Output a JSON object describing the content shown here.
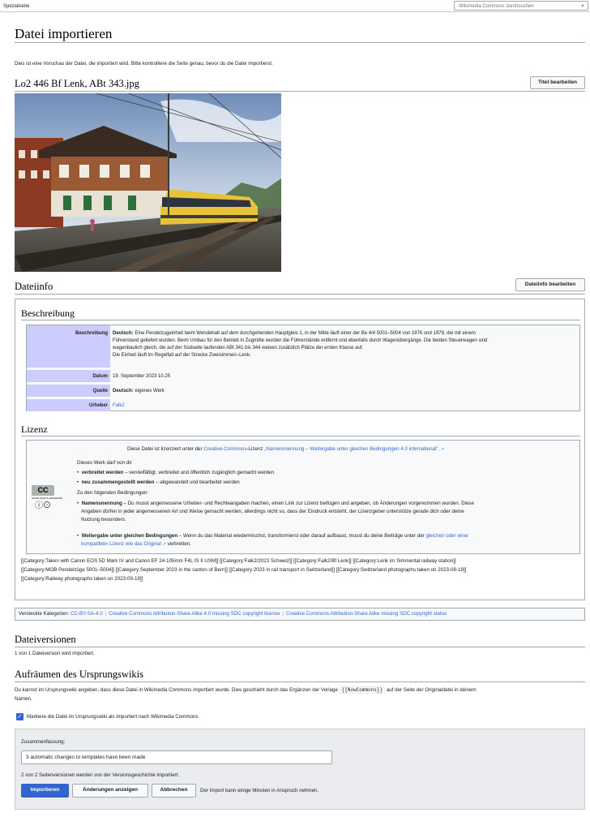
{
  "topbar": {
    "special_page": "Spezialseite",
    "search_placeholder": "Wikimedia Commons durchsuchen"
  },
  "page_title": "Datei importieren",
  "intro": "Dies ist eine Vorschau der Datei, die importiert wird. Bitte kontrolliere die Seite genau, bevor du die Datei importierst.",
  "file_title": "Lo2 446 Bf Lenk, ABt 343.jpg",
  "edit_title_button": "Titel bearbeiten",
  "fileinfo_heading": "Dateiinfo",
  "edit_fileinfo_button": "Dateiinfo bearbeiten",
  "description": {
    "heading": "Beschreibung",
    "label_description": "Beschreibung",
    "lang": "Deutsch:",
    "lines": [
      "Eine Pendelzugeinheit beim Wendehalt auf dem durchgehenden Hauptgleis 1, in der Mitte läuft einer der Be 4/4 5001–5004 von 1976 und 1979, die mit einem",
      "Führerstand geliefert wurden. Beim Umbau für den Betrieb in Zugmitte wurden die Führerstände entfernt und ebenfalls durch Wagenübergänge. Die beiden Steuerwagen sind",
      "wagenbaulich gleich, die auf der Südseite laufenden ABt 341 bis 344 weisen zusätzlich Plätze der ersten Klasse auf.",
      "Die Einheit läuft im Regelfall auf der Strecke Zweisimmen–Lenk."
    ],
    "label_date": "Datum",
    "date": "19. September 2023 10.25",
    "label_source": "Quelle",
    "source_lang": "Deutsch:",
    "source": "eigenes Werk",
    "label_author": "Urheber",
    "author": "Falk2"
  },
  "license": {
    "heading": "Lizenz",
    "intro_pre": "Diese Datei ist lizenziert unter der",
    "cc_link": "Creative-Commons",
    "intro_mid": "-Lizenz",
    "license_link": "„Namensnennung – Weitergabe unter gleichen Bedingungen 4.0 international“.",
    "free_to": "Dieses Werk darf von dir",
    "share_bold": "verbreitet werden",
    "share_text": "– vervielfältigt, verbreitet und öffentlich zugänglich gemacht werden",
    "remix_bold": "neu zusammengestellt werden",
    "remix_text": "– abgewandelt und bearbeitet werden",
    "conditions": "Zu den folgenden Bedingungen:",
    "attr_bold": "Namensnennung",
    "attr_lines": [
      "– Du musst angemessene Urheber- und Rechteangaben machen, einen Link zur Lizenz beifügen und angeben, ob Änderungen vorgenommen wurden. Diese",
      "Angaben dürfen in jeder angemessenen Art und Weise gemacht werden, allerdings nicht so, dass der Eindruck entsteht, der Lizenzgeber unterstütze gerade dich oder deine",
      "Nutzung besonders."
    ],
    "sa_bold": "Weitergabe unter gleichen Bedingungen",
    "sa_text": "– Wenn du das Material wiedermischst, transformierst oder darauf aufbaust, musst du deine Beiträge unter der",
    "sa_link1": "gleichen oder einer",
    "sa_link2": "kompatiblen Lizenz wie das Original",
    "sa_end": "verbreiten.",
    "logo_top": "CC",
    "logo_caption": "SOME RIGHTS RESERVED"
  },
  "categories_raw": [
    "[[Category:Taken with Canon EOS 5D Mark IV and Canon EF 24-105mm F4L IS II USM]] [[Category:Falk2/2023 Schweiz]] [[Category:Falk2/Bf Lenk]] [[Category:Lenk im Simmental railway station]]",
    "[[Category:MOB Pendelzüge 5001–5004]] [[Category:September 2023 in the canton of Bern]] [[Category:2023 in rail transport in Switzerland]] [[Category:Switzerland photographs taken on 2023-09-19]]",
    "[[Category:Railway photographs taken on 2023-09-19]]"
  ],
  "hidden_categories": {
    "label": "Versteckte Kategorien:",
    "items": [
      "CC-BY-SA-4.0",
      "Creative Commons Attribution-Share Alike 4.0 missing SDC copyright license",
      "Creative Commons Attribution-Share Alike missing SDC copyright status"
    ]
  },
  "versions": {
    "heading": "Dateiversionen",
    "text": "1 von 1 Dateiversion wird importiert."
  },
  "cleanup": {
    "heading": "Aufräumen des Ursprungswikis",
    "text_pre": "Du kannst im Ursprungswiki angeben, dass diese Datei in Wikimedia Commons importiert wurde. Dies geschieht durch das Ergänzen der Vorlage",
    "template": "{{NowCommons}}",
    "text_post": "auf der Seite der Originaldatei in deinem",
    "text_line2": "Namen.",
    "checkbox_label": "Markiere die Datei im Ursprungswiki als importiert nach Wikimedia Commons"
  },
  "summary": {
    "label": "Zusammenfassung:",
    "value": "3 automatic changes to templates have been made",
    "revisions": "2 von 2 Seitenversionen werden von der Versionsgeschichte importiert.",
    "import_button": "Importieren",
    "show_changes_button": "Änderungen anzeigen",
    "cancel_button": "Abbrechen",
    "note": "Der Import kann einige Minuten in Anspruch nehmen."
  },
  "colors": {
    "accent": "#3366cc",
    "label_bg": "#ccccff",
    "box_bg": "#f8f9fa"
  }
}
